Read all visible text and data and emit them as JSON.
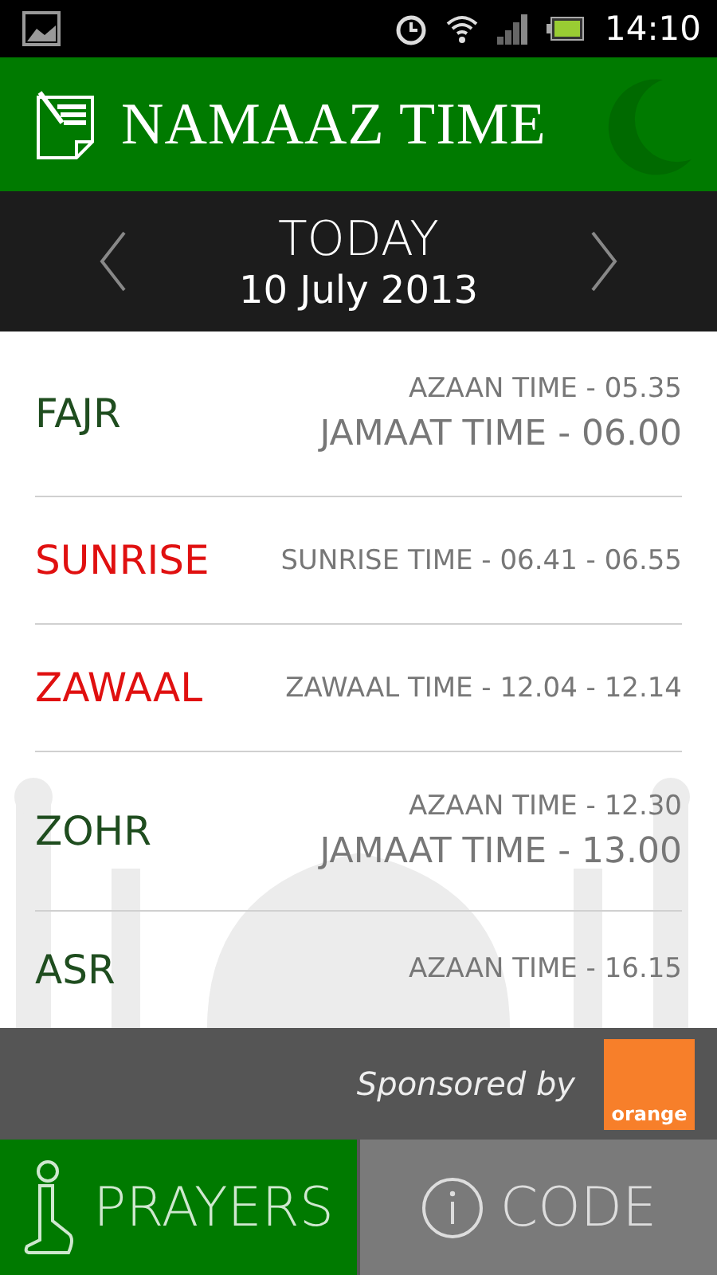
{
  "status_bar": {
    "time": "14:10"
  },
  "header": {
    "title": "NAMAAZ TIME"
  },
  "date_bar": {
    "day": "TODAY",
    "date": "10 July 2013"
  },
  "prayers": [
    {
      "kind": "prayer",
      "name": "FAJR",
      "color": "#1f4d1f",
      "lines": [
        "AZAAN TIME - 05.35",
        "JAMAAT TIME - 06.00"
      ]
    },
    {
      "kind": "range",
      "name": "SUNRISE",
      "color": "#e01010",
      "lines": [
        "SUNRISE TIME - 06.41 - 06.55"
      ]
    },
    {
      "kind": "range",
      "name": "ZAWAAL",
      "color": "#e01010",
      "lines": [
        "ZAWAAL TIME - 12.04 - 12.14"
      ]
    },
    {
      "kind": "prayer",
      "name": "ZOHR",
      "color": "#1f4d1f",
      "lines": [
        "AZAAN TIME - 12.30",
        "JAMAAT TIME - 13.00"
      ]
    },
    {
      "kind": "prayer",
      "name": "ASR",
      "color": "#1f4d1f",
      "lines": [
        "AZAAN TIME - 16.15"
      ]
    }
  ],
  "sponsor": {
    "text": "Sponsored by",
    "logo": "orange"
  },
  "tabs": [
    {
      "label": "PRAYERS",
      "selected": true
    },
    {
      "label": "CODE",
      "selected": false
    }
  ]
}
